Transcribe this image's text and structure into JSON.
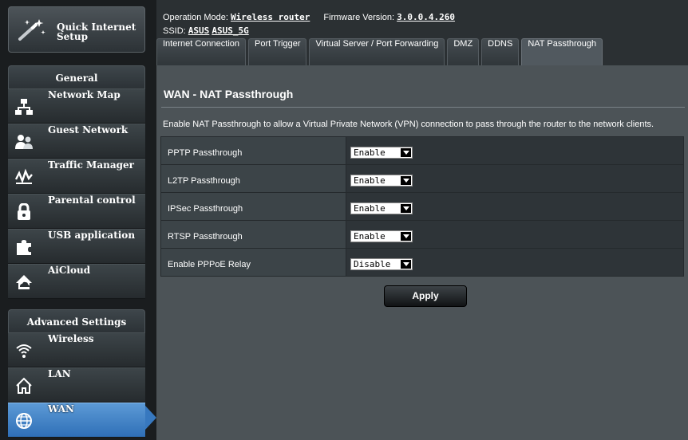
{
  "sidebar": {
    "quick_setup_label": "Quick Internet Setup",
    "general_header": "General",
    "general_items": [
      {
        "label": "Network Map",
        "icon": "network-map-icon"
      },
      {
        "label": "Guest Network",
        "icon": "guest-network-icon"
      },
      {
        "label": "Traffic Manager",
        "icon": "traffic-manager-icon"
      },
      {
        "label": "Parental control",
        "icon": "lock-icon"
      },
      {
        "label": "USB application",
        "icon": "puzzle-icon"
      },
      {
        "label": "AiCloud",
        "icon": "cloud-icon"
      }
    ],
    "advanced_header": "Advanced Settings",
    "advanced_items": [
      {
        "label": "Wireless",
        "icon": "wifi-icon"
      },
      {
        "label": "LAN",
        "icon": "home-icon"
      },
      {
        "label": "WAN",
        "icon": "globe-icon",
        "active": true
      }
    ]
  },
  "header": {
    "operation_mode_label": "Operation Mode:",
    "operation_mode_value": "Wireless router",
    "firmware_label": "Firmware Version:",
    "firmware_value": "3.0.0.4.260",
    "ssid_label": "SSID:",
    "ssid_values": [
      "ASUS",
      "ASUS_5G"
    ]
  },
  "tabs": [
    "Internet Connection",
    "Port Trigger",
    "Virtual Server / Port Forwarding",
    "DMZ",
    "DDNS",
    "NAT Passthrough"
  ],
  "active_tab": "NAT Passthrough",
  "main": {
    "title": "WAN - NAT Passthrough",
    "description": "Enable NAT Passthrough to allow a Virtual Private Network (VPN) connection to pass through the router to the network clients.",
    "rows": [
      {
        "label": "PPTP Passthrough",
        "value": "Enable"
      },
      {
        "label": "L2TP Passthrough",
        "value": "Enable"
      },
      {
        "label": "IPSec Passthrough",
        "value": "Enable"
      },
      {
        "label": "RTSP Passthrough",
        "value": "Enable"
      },
      {
        "label": "Enable PPPoE Relay",
        "value": "Disable"
      }
    ],
    "apply_label": "Apply"
  },
  "colors": {
    "accent_active": "#3778bf",
    "content_bg": "#4c5357",
    "status_icon_green": "#46c837"
  }
}
